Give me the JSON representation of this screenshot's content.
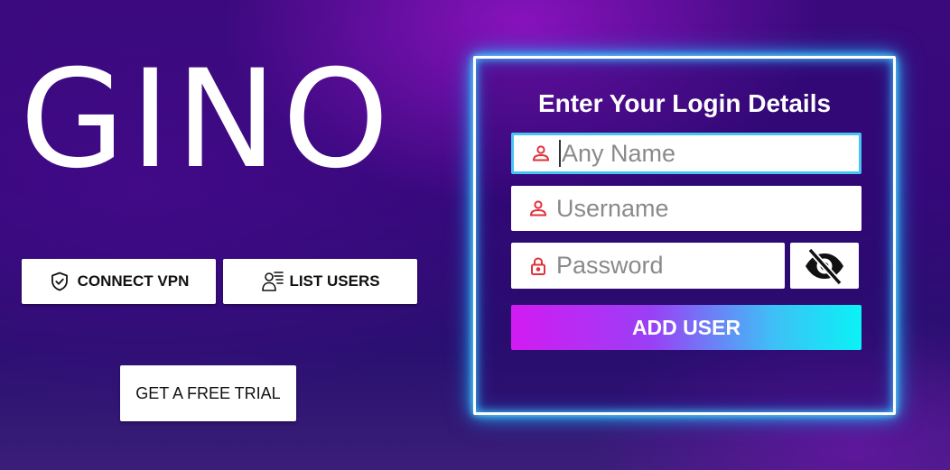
{
  "app": {
    "logo_text": "GINO"
  },
  "actions": {
    "connect_vpn": {
      "label": "CONNECT VPN",
      "icon": "shield-check-icon"
    },
    "list_users": {
      "label": "LIST USERS",
      "icon": "user-list-icon"
    },
    "free_trial": {
      "label": "GET A FREE TRIAL"
    }
  },
  "login_panel": {
    "title": "Enter Your Login Details",
    "name_field": {
      "placeholder": "Any Name",
      "value": "",
      "icon": "person-icon"
    },
    "username_field": {
      "placeholder": "Username",
      "value": "",
      "icon": "person-icon"
    },
    "password_field": {
      "placeholder": "Password",
      "value": "",
      "icon": "lock-icon"
    },
    "visibility_toggle": {
      "icon": "eye-off-icon"
    },
    "submit": {
      "label": "ADD USER"
    }
  },
  "colors": {
    "accent_red": "#e0323a",
    "panel_glow": "#2fb8ff",
    "button_gradient_start": "#d21bf2",
    "button_gradient_end": "#0af2f6"
  }
}
